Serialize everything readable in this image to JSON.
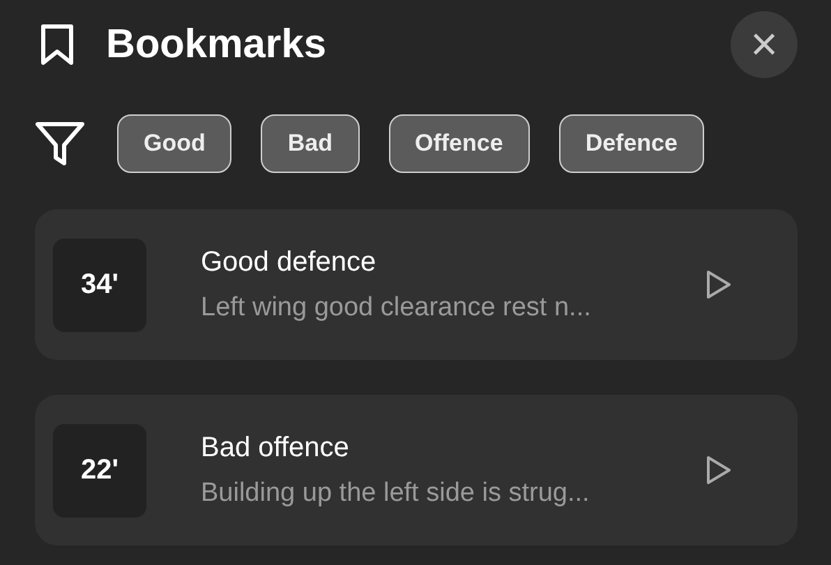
{
  "header": {
    "title": "Bookmarks",
    "close": "×"
  },
  "filters": [
    {
      "label": "Good"
    },
    {
      "label": "Bad"
    },
    {
      "label": "Offence"
    },
    {
      "label": "Defence"
    }
  ],
  "bookmarks": [
    {
      "time": "34'",
      "title": "Good defence",
      "note": "Left wing good clearance rest n..."
    },
    {
      "time": "22'",
      "title": "Bad offence",
      "note": "Building up the left side is strug..."
    }
  ]
}
